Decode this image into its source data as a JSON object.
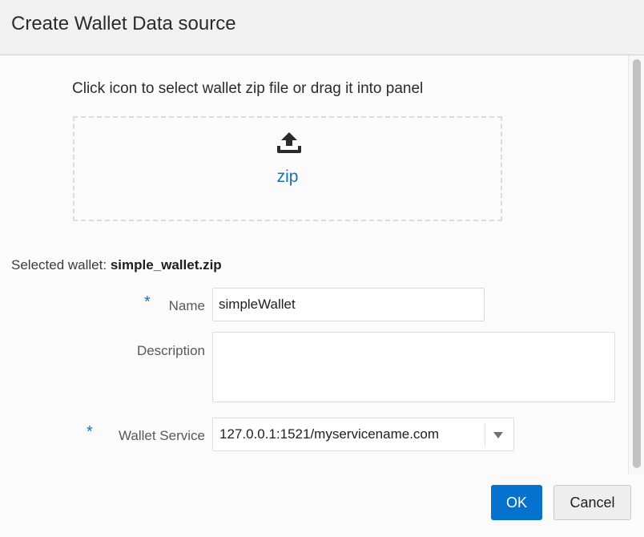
{
  "dialog": {
    "title": "Create Wallet Data source"
  },
  "upload": {
    "instruction": "Click icon to select wallet zip file or drag it into panel",
    "icon": "upload-icon",
    "link_label": "zip"
  },
  "selected_wallet": {
    "label": "Selected wallet:",
    "filename": "simple_wallet.zip"
  },
  "form": {
    "required_marker": "*",
    "name": {
      "label": "Name",
      "value": "simpleWallet",
      "required": true
    },
    "description": {
      "label": "Description",
      "value": "",
      "required": false
    },
    "wallet_service": {
      "label": "Wallet Service",
      "value": "127.0.0.1:1521/myservicename.com",
      "required": true,
      "icon": "chevron-down-icon"
    }
  },
  "buttons": {
    "ok": "OK",
    "cancel": "Cancel"
  },
  "colors": {
    "accent": "#0572ce",
    "link": "#1f6fac"
  }
}
